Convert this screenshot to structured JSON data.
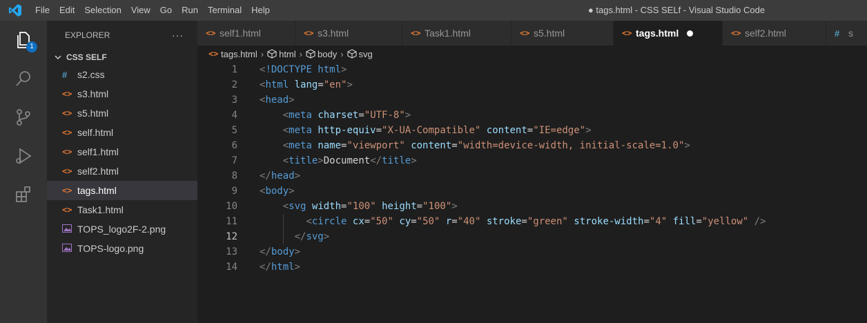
{
  "titlebar": {
    "menu": [
      "File",
      "Edit",
      "Selection",
      "View",
      "Go",
      "Run",
      "Terminal",
      "Help"
    ],
    "window_title": "● tags.html - CSS SELf - Visual Studio Code"
  },
  "activitybar": {
    "explorer_badge": "1"
  },
  "sidebar": {
    "header": "EXPLORER",
    "more": "···",
    "folder": "CSS SELF",
    "files": [
      {
        "icon": "#",
        "name": "s2.css"
      },
      {
        "icon": "<>",
        "name": "s3.html"
      },
      {
        "icon": "<>",
        "name": "s5.html"
      },
      {
        "icon": "<>",
        "name": "self.html"
      },
      {
        "icon": "<>",
        "name": "self1.html"
      },
      {
        "icon": "<>",
        "name": "self2.html"
      },
      {
        "icon": "<>",
        "name": "tags.html"
      },
      {
        "icon": "<>",
        "name": "Task1.html"
      },
      {
        "icon": "img",
        "name": "TOPS_logo2F-2.png"
      },
      {
        "icon": "img",
        "name": "TOPS-logo.png"
      }
    ]
  },
  "tabs": [
    {
      "icon": "<>",
      "label": "self1.html"
    },
    {
      "icon": "<>",
      "label": "s3.html"
    },
    {
      "icon": "<>",
      "label": "Task1.html"
    },
    {
      "icon": "<>",
      "label": "s5.html"
    },
    {
      "icon": "<>",
      "label": "tags.html"
    },
    {
      "icon": "<>",
      "label": "self2.html"
    },
    {
      "icon": "#",
      "label": "s"
    }
  ],
  "breadcrumb": [
    "tags.html",
    "html",
    "body",
    "svg"
  ],
  "editor": {
    "line_numbers": [
      "1",
      "2",
      "3",
      "4",
      "5",
      "6",
      "7",
      "8",
      "9",
      "10",
      "11",
      "12",
      "13",
      "14"
    ],
    "current_line": "12",
    "lines": [
      "<!DOCTYPE html>",
      "<html lang=\"en\">",
      "<head>",
      "    <meta charset=\"UTF-8\">",
      "    <meta http-equiv=\"X-UA-Compatible\" content=\"IE=edge\">",
      "    <meta name=\"viewport\" content=\"width=device-width, initial-scale=1.0\">",
      "    <title>Document</title>",
      "</head>",
      "<body>",
      "    <svg width=\"100\" height=\"100\">",
      "        <circle cx=\"50\" cy=\"50\" r=\"40\" stroke=\"green\" stroke-width=\"4\" fill=\"yellow\" />",
      "      </svg>",
      "</body>",
      "</html>"
    ]
  },
  "colors": {
    "accent": "#0e70c0",
    "html_icon": "#e37933",
    "css_icon": "#519aba",
    "tag": "#569cd6",
    "attribute": "#9cdcfe",
    "string": "#ce9178"
  }
}
